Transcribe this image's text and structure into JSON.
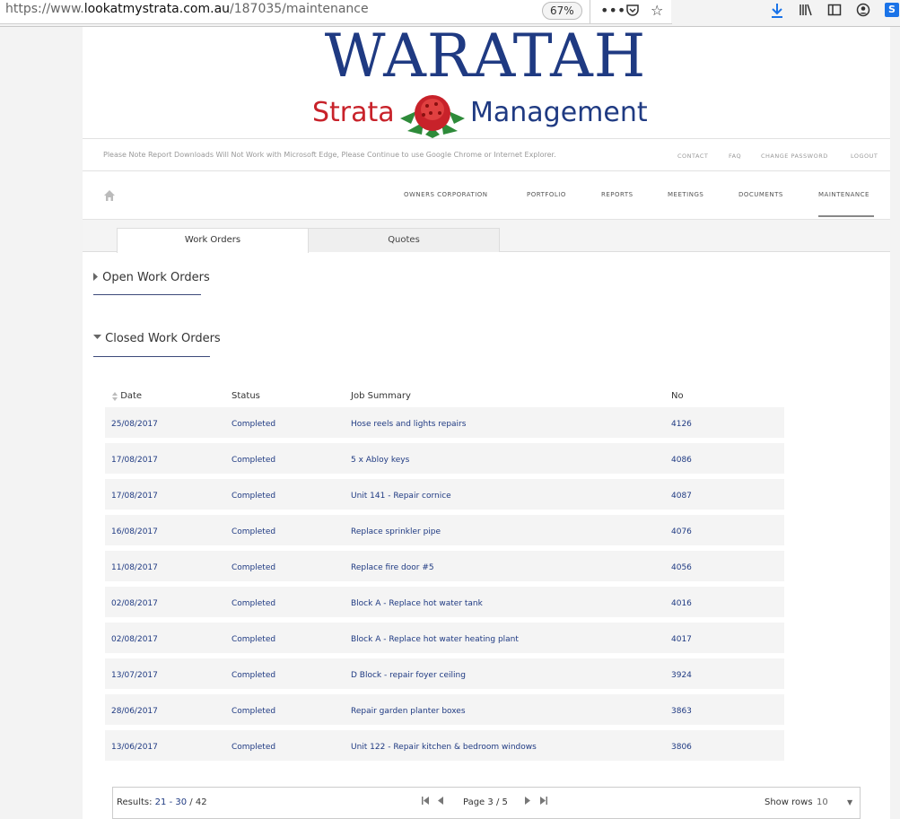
{
  "browser": {
    "url_scheme": "https://www.",
    "url_host": "lookatmystrata.com.au",
    "url_path": "/187035/maintenance",
    "zoom": "67%",
    "ext_badge": "S"
  },
  "logo": {
    "title": "WARATAH",
    "word1": "Strata",
    "word2": "Management"
  },
  "notice": "Please Note Report Downloads Will Not Work with Microsoft Edge, Please Continue to use Google Chrome or Internet Explorer.",
  "toplinks": [
    "CONTACT",
    "FAQ",
    "CHANGE PASSWORD",
    "LOGOUT"
  ],
  "nav": [
    "OWNERS CORPORATION",
    "PORTFOLIO",
    "REPORTS",
    "MEETINGS",
    "DOCUMENTS",
    "MAINTENANCE"
  ],
  "tabs": [
    "Work Orders",
    "Quotes"
  ],
  "sections": {
    "open": "Open Work Orders",
    "closed": "Closed Work Orders"
  },
  "table": {
    "headers": [
      "Date",
      "Status",
      "Job Summary",
      "No"
    ],
    "rows": [
      [
        "25/08/2017",
        "Completed",
        "Hose reels and lights repairs",
        "4126"
      ],
      [
        "17/08/2017",
        "Completed",
        "5 x Abloy keys",
        "4086"
      ],
      [
        "17/08/2017",
        "Completed",
        "Unit 141 - Repair cornice",
        "4087"
      ],
      [
        "16/08/2017",
        "Completed",
        "Replace sprinkler pipe",
        "4076"
      ],
      [
        "11/08/2017",
        "Completed",
        "Replace fire door #5",
        "4056"
      ],
      [
        "02/08/2017",
        "Completed",
        "Block A - Replace hot water tank",
        "4016"
      ],
      [
        "02/08/2017",
        "Completed",
        "Block A - Replace hot water heating plant",
        "4017"
      ],
      [
        "13/07/2017",
        "Completed",
        "D Block - repair foyer ceiling",
        "3924"
      ],
      [
        "28/06/2017",
        "Completed",
        "Repair garden planter boxes",
        "3863"
      ],
      [
        "13/06/2017",
        "Completed",
        "Unit 122 - Repair kitchen & bedroom windows",
        "3806"
      ]
    ]
  },
  "pager": {
    "results_label": "Results:",
    "range": "21 - 30",
    "total": "/ 42",
    "page_label": "Page",
    "page": "3 / 5",
    "show_rows_label": "Show rows",
    "rows_value": "10"
  },
  "colors": {
    "brand_blue": "#1f3a82",
    "brand_red": "#c8222a"
  }
}
